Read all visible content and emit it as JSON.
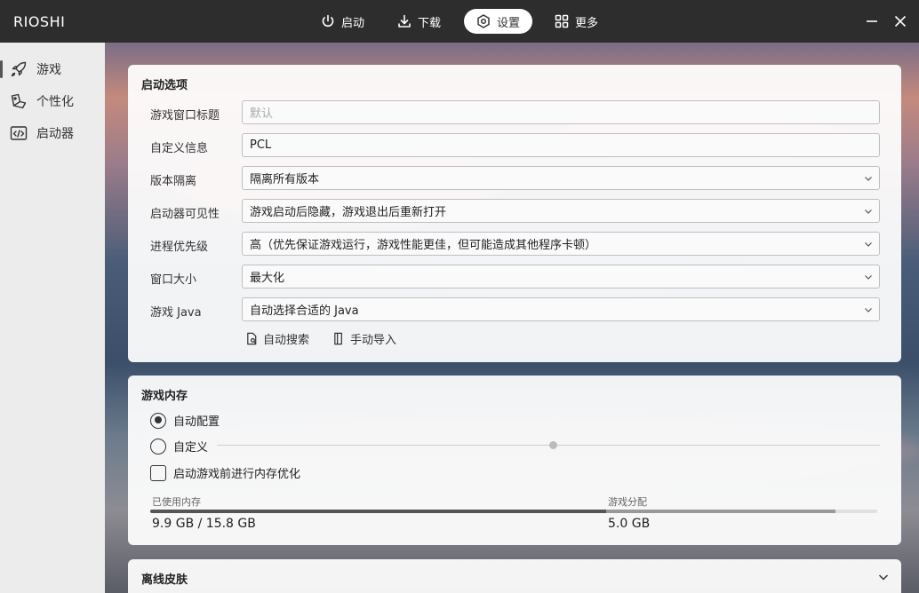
{
  "app": {
    "title": "RIOSHI"
  },
  "topnav": [
    {
      "label": "启动",
      "icon": "power-icon",
      "active": false
    },
    {
      "label": "下载",
      "icon": "download-icon",
      "active": false
    },
    {
      "label": "设置",
      "icon": "settings-icon",
      "active": true
    },
    {
      "label": "更多",
      "icon": "grid-icon",
      "active": false
    }
  ],
  "sidebar": {
    "items": [
      {
        "label": "游戏",
        "icon": "rocket-icon"
      },
      {
        "label": "个性化",
        "icon": "palette-icon"
      },
      {
        "label": "启动器",
        "icon": "code-icon"
      }
    ]
  },
  "launch_options": {
    "title": "启动选项",
    "rows": [
      {
        "label": "游戏窗口标题",
        "value": "",
        "placeholder": "默认",
        "dropdown": false
      },
      {
        "label": "自定义信息",
        "value": "PCL",
        "placeholder": "",
        "dropdown": false
      },
      {
        "label": "版本隔离",
        "value": "隔离所有版本",
        "placeholder": "",
        "dropdown": true
      },
      {
        "label": "启动器可见性",
        "value": "游戏启动后隐藏，游戏退出后重新打开",
        "placeholder": "",
        "dropdown": true
      },
      {
        "label": "进程优先级",
        "value": "高（优先保证游戏运行，游戏性能更佳，但可能造成其他程序卡顿）",
        "placeholder": "",
        "dropdown": true
      },
      {
        "label": "窗口大小",
        "value": "最大化",
        "placeholder": "",
        "dropdown": true
      },
      {
        "label": "游戏 Java",
        "value": "自动选择合适的 Java",
        "placeholder": "",
        "dropdown": true
      }
    ],
    "auto_search_label": "自动搜索",
    "manual_import_label": "手动导入"
  },
  "memory": {
    "title": "游戏内存",
    "auto_label": "自动配置",
    "custom_label": "自定义",
    "optimize_label": "启动游戏前进行内存优化",
    "used_label": "已使用内存",
    "used_value": "9.9 GB / 15.8 GB",
    "alloc_label": "游戏分配",
    "alloc_value": "5.0 GB",
    "used_fraction": 0.627,
    "alloc_fraction": 0.316
  },
  "offline_skin": {
    "title": "离线皮肤"
  },
  "colors": {
    "topbar": "#2d2d2d",
    "sidebar": "#ececec",
    "accent": "#333333"
  }
}
